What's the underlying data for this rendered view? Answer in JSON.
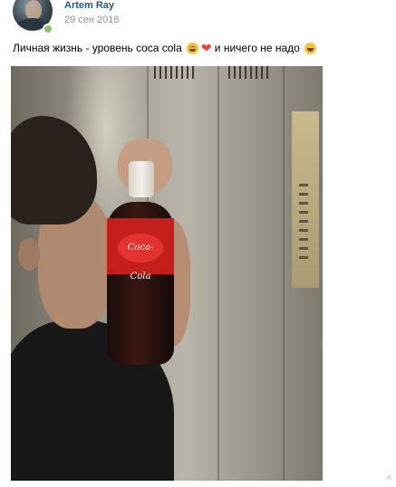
{
  "post": {
    "author": "Artem Ray",
    "date": "29 сен 2016",
    "online": true,
    "text_before_emoji": "Личная жизнь - уровень coca cola",
    "emojis_inline": [
      "face-with-tears-of-joy",
      "red-heart"
    ],
    "text_after_emoji": "и ничего не надо",
    "emoji_end": "grinning-face",
    "photo_alt_logo": "Coca-Cola"
  },
  "colors": {
    "author_link": "#2a5885",
    "date": "#939393",
    "online": "#8ac176"
  },
  "ui": {
    "more_chevron_glyph": "^ "
  }
}
